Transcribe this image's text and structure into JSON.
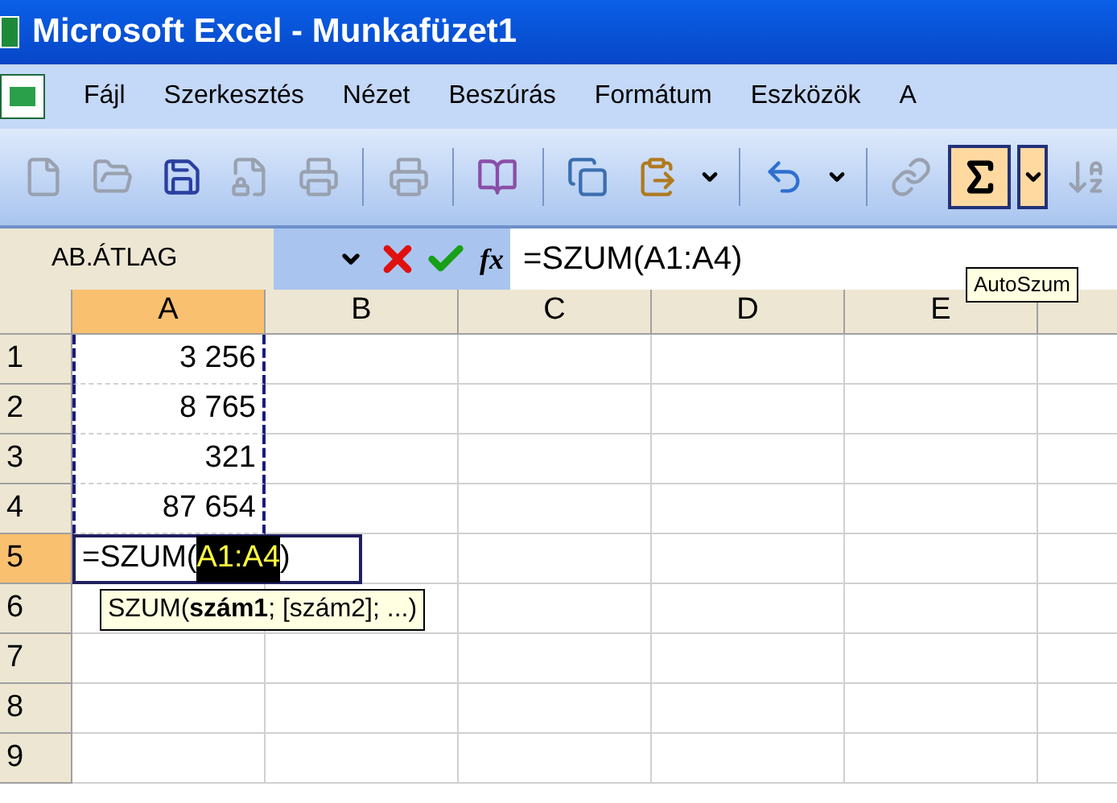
{
  "window": {
    "title": "Microsoft Excel - Munkafüzet1"
  },
  "menu": [
    "Fájl",
    "Szerkesztés",
    "Nézet",
    "Beszúrás",
    "Formátum",
    "Eszközök",
    "A"
  ],
  "toolbar": [
    {
      "kind": "new"
    },
    {
      "kind": "open"
    },
    {
      "kind": "save"
    },
    {
      "kind": "permission"
    },
    {
      "kind": "print"
    },
    {
      "kind": "separator"
    },
    {
      "kind": "print"
    },
    {
      "kind": "separator"
    },
    {
      "kind": "research"
    },
    {
      "kind": "separator"
    },
    {
      "kind": "copy"
    },
    {
      "kind": "paste"
    },
    {
      "kind": "dropdown"
    },
    {
      "kind": "separator"
    },
    {
      "kind": "undo"
    },
    {
      "kind": "dropdown"
    },
    {
      "kind": "separator"
    },
    {
      "kind": "link"
    },
    {
      "kind": "sum",
      "pressed": true
    },
    {
      "kind": "dropdown",
      "pressed": true
    },
    {
      "kind": "sort"
    }
  ],
  "formula_bar": {
    "name_box": "AB.ÁTLAG",
    "function_label": "fx",
    "formula": "=SZUM(A1:A4)"
  },
  "autosum_tooltip": "AutoSzum",
  "columns": [
    {
      "label": "A",
      "selected": true
    },
    {
      "label": "B",
      "selected": false
    },
    {
      "label": "C",
      "selected": false
    },
    {
      "label": "D",
      "selected": false
    },
    {
      "label": "E",
      "selected": false
    }
  ],
  "rows": [
    {
      "label": "1",
      "selected": false,
      "a": "3 256",
      "in_range": true
    },
    {
      "label": "2",
      "selected": false,
      "a": "8 765",
      "in_range": true
    },
    {
      "label": "3",
      "selected": false,
      "a": "321",
      "in_range": true
    },
    {
      "label": "4",
      "selected": false,
      "a": "87 654",
      "in_range": true
    },
    {
      "label": "5",
      "selected": true,
      "in_range": false,
      "editing": {
        "before": "=SZUM(",
        "reference": "A1:A4",
        "after": ")"
      },
      "hint": "SZUM(**szám1**; [szám2]; ...)"
    },
    {
      "label": "6",
      "selected": false,
      "in_range": false
    },
    {
      "label": "7",
      "selected": false,
      "in_range": false
    },
    {
      "label": "8",
      "selected": false,
      "in_range": false
    },
    {
      "label": "9",
      "selected": false,
      "in_range": false
    }
  ]
}
